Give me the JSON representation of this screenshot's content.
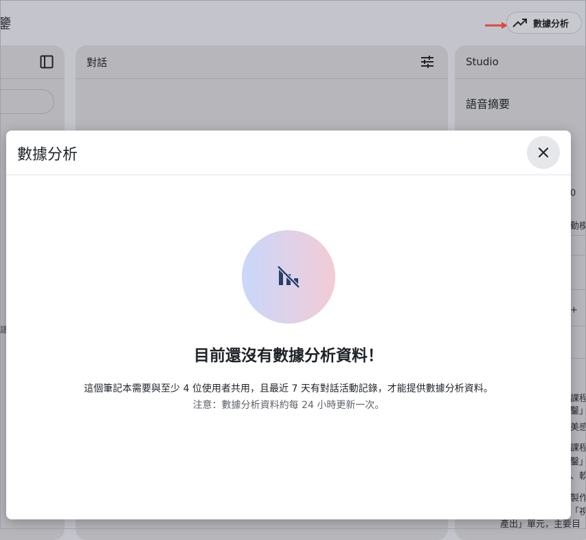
{
  "app": {
    "partial_title": "鑒",
    "analytics_button_label": "數據分析"
  },
  "panels": {
    "chat_title": "對話",
    "studio_title": "Studio",
    "studio_sub": "語音摘要",
    "studio_fragments": [
      "0",
      "動模",
      "+",
      "課程",
      "鑿」",
      "美感",
      "課程",
      "鑿」",
      "、軟",
      "製作",
      "「視",
      "產出」單元，主要目"
    ],
    "left_side_text": "譜"
  },
  "dialog": {
    "title": "數據分析",
    "empty_title": "目前還沒有數據分析資料！",
    "description": "這個筆記本需要與至少 4 位使用者共用，且最近 7 天有對話活動記錄，才能提供數據分析資料。",
    "note": "注意：數據分析資料約每 24 小時更新一次。"
  },
  "icons": {
    "analytics": "trending-up-icon",
    "close": "close-icon",
    "empty_state": "chart-off-icon",
    "panel_toggle": "panel-icon",
    "tune": "tune-icon"
  },
  "colors": {
    "arrow": "#e0463c",
    "icon_dark": "#27406b"
  }
}
